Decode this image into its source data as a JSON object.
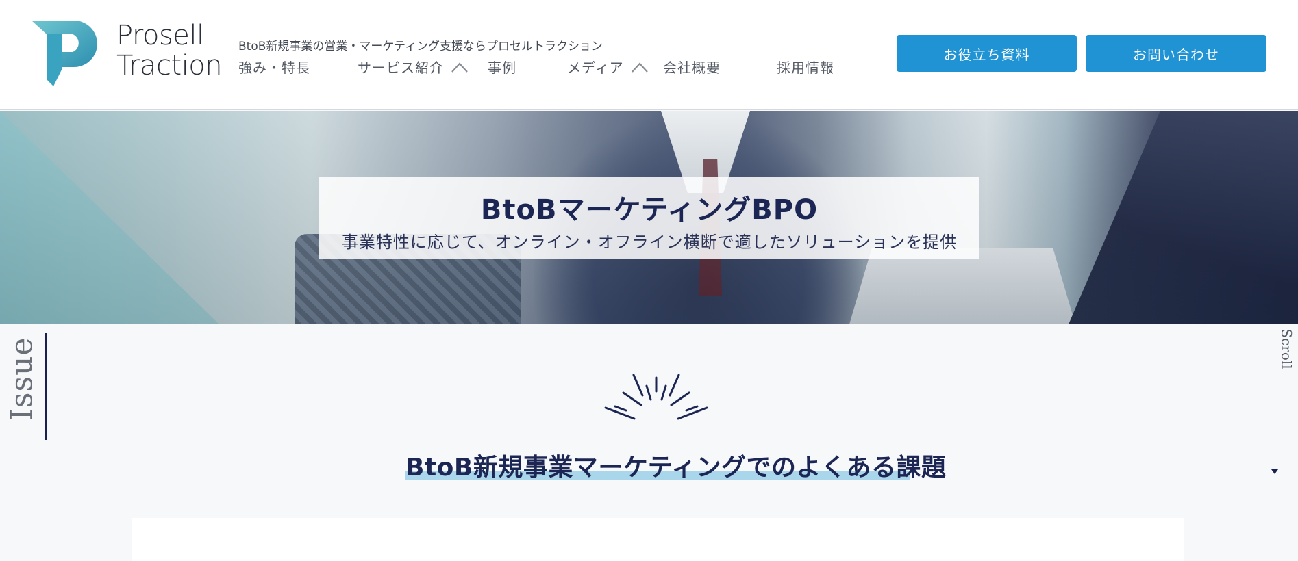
{
  "header": {
    "logo_line1": "Prosell",
    "logo_line2": "Traction",
    "tagline": "BtoB新規事業の営業・マーケティング支援ならプロセルトラクション",
    "nav": [
      {
        "label": "強み・特長",
        "has_dropdown": false
      },
      {
        "label": "サービス紹介",
        "has_dropdown": true
      },
      {
        "label": "事例",
        "has_dropdown": false
      },
      {
        "label": "メディア",
        "has_dropdown": true
      },
      {
        "label": "会社概要",
        "has_dropdown": false
      },
      {
        "label": "採用情報",
        "has_dropdown": false
      }
    ],
    "buttons": {
      "docs": "お役立ち資料",
      "contact": "お問い合わせ"
    }
  },
  "hero": {
    "title": "BtoBマーケティングBPO",
    "subtitle": "事業特性に応じて、オンライン・オフライン横断で適したソリューションを提供"
  },
  "issue": {
    "side_label": "Issue",
    "heading": "BtoB新規事業マーケティングでのよくある課題"
  },
  "scroll": {
    "label": "Scroll"
  },
  "colors": {
    "accent_button": "#1f93d3",
    "navy_text": "#1c2654",
    "highlight": "#a9d6ea",
    "logo_teal": "#4bb3c6"
  }
}
